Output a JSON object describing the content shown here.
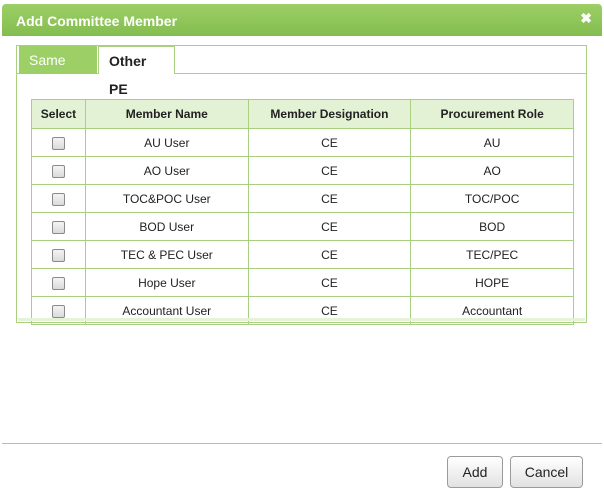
{
  "dialog": {
    "title": "Add Committee Member",
    "close_icon": "close-icon"
  },
  "tabs": [
    {
      "label": "Same PE",
      "active": true
    },
    {
      "label": "Other PE",
      "active": false
    }
  ],
  "table": {
    "headers": [
      "Select",
      "Member Name",
      "Member Designation",
      "Procurement Role"
    ],
    "rows": [
      {
        "name": "AU User",
        "designation": "CE",
        "role": "AU",
        "checked": false
      },
      {
        "name": "AO User",
        "designation": "CE",
        "role": "AO",
        "checked": false
      },
      {
        "name": "TOC&POC User",
        "designation": "CE",
        "role": "TOC/POC",
        "checked": false
      },
      {
        "name": "BOD User",
        "designation": "CE",
        "role": "BOD",
        "checked": false
      },
      {
        "name": "TEC & PEC User",
        "designation": "CE",
        "role": "TEC/PEC",
        "checked": false
      },
      {
        "name": "Hope User",
        "designation": "CE",
        "role": "HOPE",
        "checked": false
      },
      {
        "name": "Accountant User",
        "designation": "CE",
        "role": "Accountant",
        "checked": false
      }
    ]
  },
  "buttons": {
    "add_label": "Add",
    "cancel_label": "Cancel"
  },
  "colors": {
    "accent": "#9ccf66",
    "border": "#a8d080",
    "header_bg": "#e3f1d4"
  }
}
